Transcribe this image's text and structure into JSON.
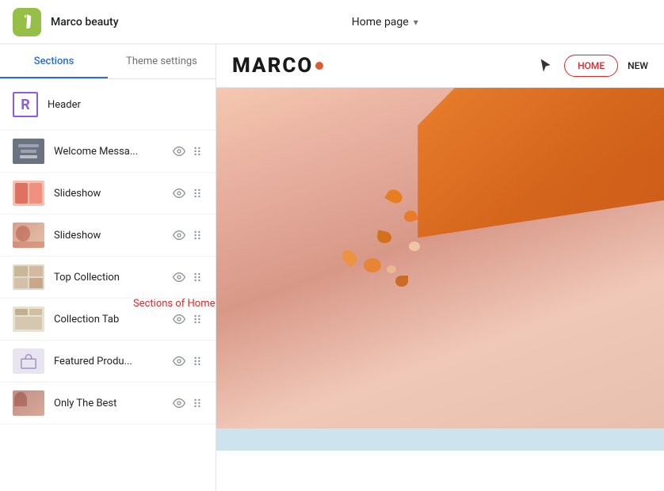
{
  "topbar": {
    "store_name": "Marco beauty",
    "page_selector_label": "Home page",
    "chevron": "▾"
  },
  "sidebar": {
    "tabs": [
      {
        "id": "sections",
        "label": "Sections",
        "active": true
      },
      {
        "id": "theme_settings",
        "label": "Theme settings",
        "active": false
      }
    ],
    "header_item": {
      "label": "Header"
    },
    "sections": [
      {
        "id": "welcome_message",
        "label": "Welcome Messa...",
        "thumb_type": "welcome"
      },
      {
        "id": "slideshow_1",
        "label": "Slideshow",
        "thumb_type": "slideshow_pink"
      },
      {
        "id": "slideshow_2",
        "label": "Slideshow",
        "thumb_type": "slideshow_photo"
      },
      {
        "id": "top_collection",
        "label": "Top Collection",
        "thumb_type": "collection"
      },
      {
        "id": "collection_tab",
        "label": "Collection Tab",
        "thumb_type": "collection_tab"
      },
      {
        "id": "featured_produ",
        "label": "Featured Produ...",
        "thumb_type": "featured"
      },
      {
        "id": "only_the_best",
        "label": "Only The Best",
        "thumb_type": "photo"
      }
    ],
    "tooltip": "Sections of Home page"
  },
  "preview": {
    "logo_text": "MARCO",
    "home_button": "HOME",
    "new_label": "NEW"
  }
}
